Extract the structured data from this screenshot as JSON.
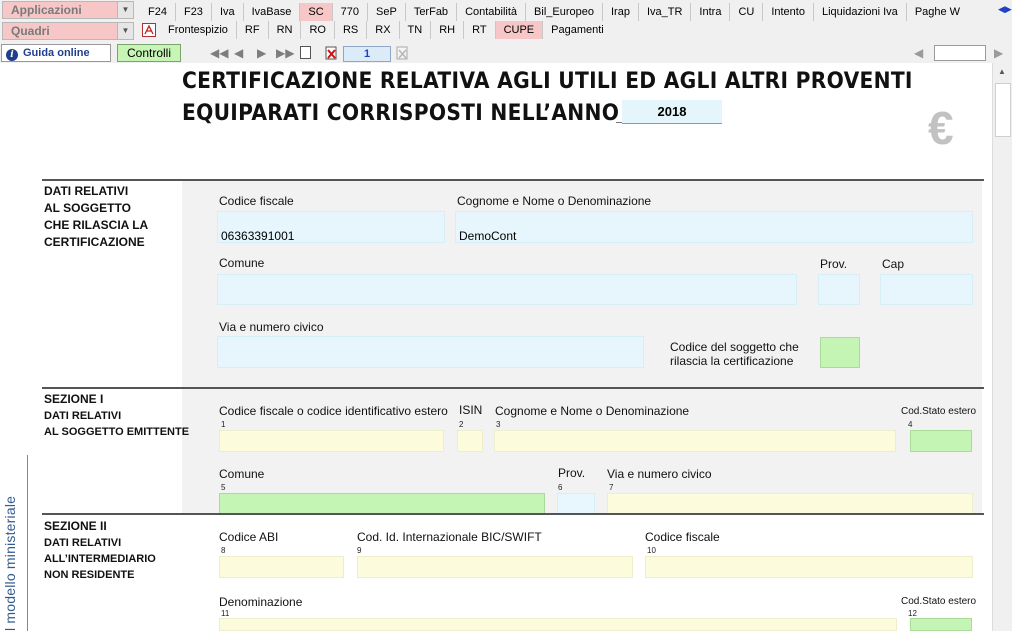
{
  "toolbar": {
    "applicazioni_label": "Applicazioni",
    "quadri_label": "Quadri",
    "app_tabs": [
      "F24",
      "F23",
      "Iva",
      "IvaBase",
      "SC",
      "770",
      "SeP",
      "TerFab",
      "Contabilità",
      "Bil_Europeo",
      "Irap",
      "Iva_TR",
      "Intra",
      "CU",
      "Intento",
      "Liquidazioni Iva",
      "Paghe W"
    ],
    "active_app_tab": "SC",
    "quadri_tabs": [
      "Frontespizio",
      "RF",
      "RN",
      "RO",
      "RS",
      "RX",
      "TN",
      "RH",
      "RT",
      "CUPE",
      "Pagamenti"
    ],
    "active_quadri_tab": "CUPE",
    "guida_label": "Guida online",
    "controlli_label": "Controlli",
    "page_number": "1"
  },
  "document": {
    "title_line1": "CERTIFICAZIONE  RELATIVA AGLI UTILI ED AGLI ALTRI PROVENTI",
    "title_line2": "EQUIPARATI CORRISPOSTI NELL’ANNO",
    "year": "2018",
    "side_text": "l modello ministeriale",
    "soggetto": {
      "label": [
        "DATI RELATIVI",
        "AL SOGGETTO",
        "CHE RILASCIA LA",
        "CERTIFICAZIONE"
      ],
      "codice_fiscale_label": "Codice fiscale",
      "codice_fiscale_value": "06363391001",
      "cognome_label": "Cognome e Nome o Denominazione",
      "cognome_value": "DemoCont",
      "comune_label": "Comune",
      "prov_label": "Prov.",
      "cap_label": "Cap",
      "via_label": "Via e numero civico",
      "codice_soggetto_label_1": "Codice del soggetto che",
      "codice_soggetto_label_2": "rilascia la certificazione"
    },
    "sezione1": {
      "title": "SEZIONE I",
      "sub": [
        "DATI RELATIVI",
        "AL SOGGETTO EMITTENTE"
      ],
      "cf_label": "Codice fiscale o codice identificativo estero",
      "isin_label": "ISIN",
      "cognome_label": "Cognome e Nome o Denominazione",
      "cod_stato_label": "Cod.Stato estero",
      "comune_label": "Comune",
      "prov_label": "Prov.",
      "via_label": "Via e numero civico",
      "nums": [
        "1",
        "2",
        "3",
        "4",
        "5",
        "6",
        "7"
      ]
    },
    "sezione2": {
      "title": "SEZIONE II",
      "sub": [
        "DATI RELATIVI",
        "ALL’INTERMEDIARIO",
        "NON RESIDENTE"
      ],
      "abi_label": "Codice ABI",
      "bic_label": "Cod. Id. Internazionale BIC/SWIFT",
      "cf_label": "Codice fiscale",
      "denominazione_label": "Denominazione",
      "cod_stato_label": "Cod.Stato estero",
      "nums": [
        "8",
        "9",
        "10",
        "11",
        "12"
      ]
    }
  }
}
